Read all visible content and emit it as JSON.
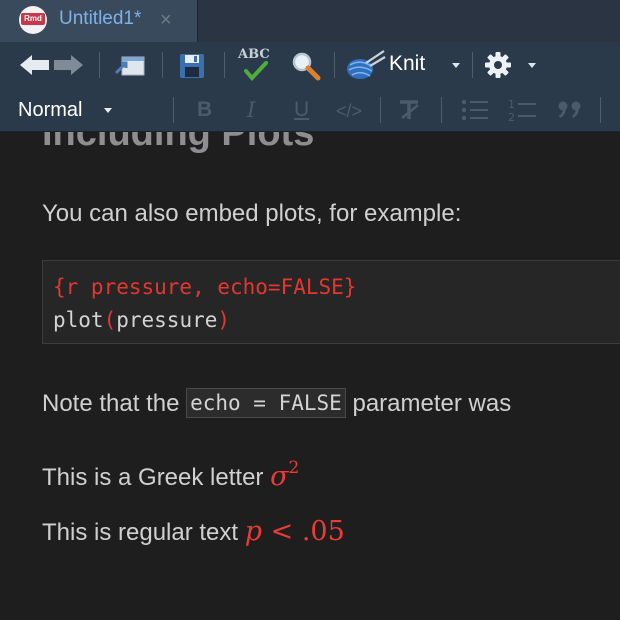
{
  "tab": {
    "icon_text": "Rmd",
    "title": "Untitled1*",
    "close_glyph": "×"
  },
  "toolbar": {
    "items": [
      {
        "name": "back-arrow-icon",
        "interactable": true
      },
      {
        "name": "forward-arrow-icon",
        "interactable": true
      },
      {
        "name": "show-in-window-icon",
        "interactable": true
      },
      {
        "name": "save-icon",
        "interactable": true
      },
      {
        "name": "spellcheck-icon",
        "interactable": true
      },
      {
        "name": "find-icon",
        "interactable": true
      },
      {
        "name": "knit-icon",
        "interactable": true
      },
      {
        "name": "gear-icon",
        "interactable": true
      }
    ],
    "spellcheck_text": "ABC",
    "knit_label": "Knit"
  },
  "format_bar": {
    "style_label": "Normal",
    "buttons": [
      "B",
      "I",
      "U",
      "</>"
    ]
  },
  "document": {
    "heading": "Including Plots",
    "intro": "You can also embed plots, for example:",
    "code_chunk": {
      "line1": "{r pressure, echo=FALSE}",
      "line2_fn": "plot",
      "line2_open": "(",
      "line2_arg": "pressure",
      "line2_close": ")"
    },
    "note_before": "Note that the ",
    "note_code": "echo = FALSE",
    "note_after": " parameter was",
    "greek_text": "This is a Greek letter ",
    "greek_symbol": "σ",
    "greek_exp": "2",
    "regular_text": "This is regular text ",
    "math_p": "p",
    "math_rest": " < .05"
  },
  "colors": {
    "accent_red": "#e5362f",
    "tab_text": "#7cb2e6",
    "toolbar_bg": "#2b3a4b"
  }
}
